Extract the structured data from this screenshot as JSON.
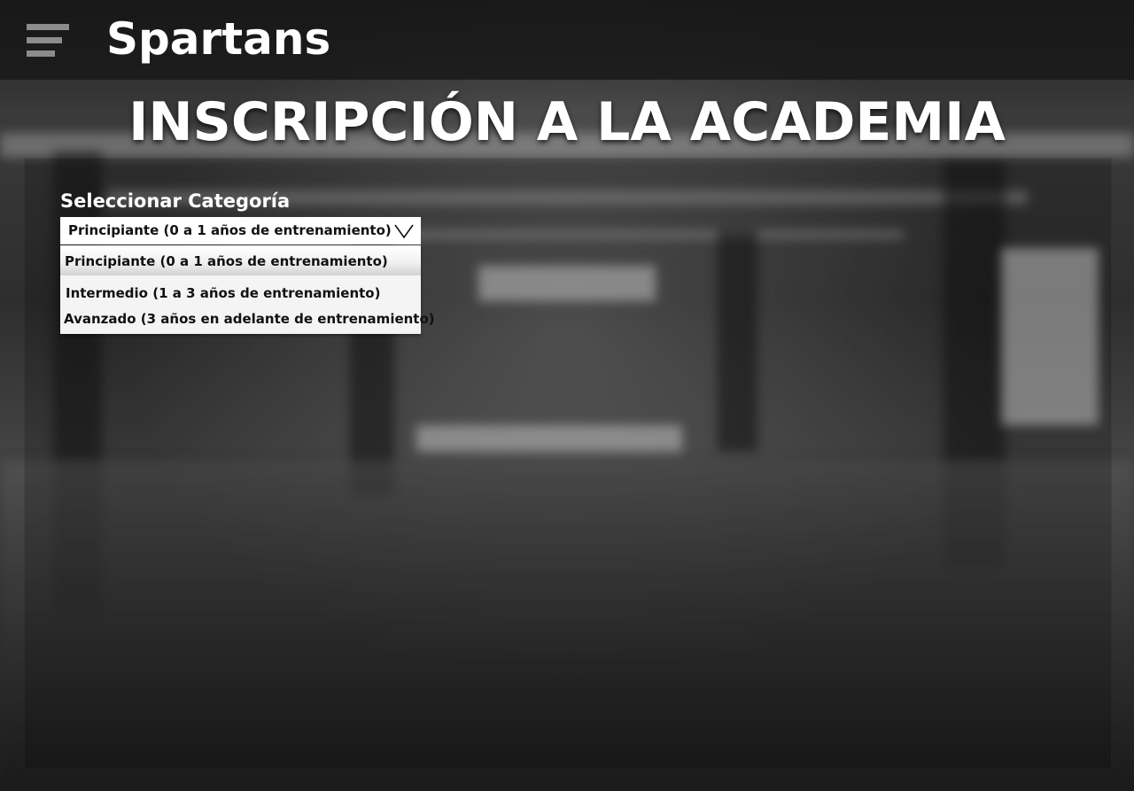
{
  "header": {
    "brand": "Spartans",
    "menu_icon": "hamburger-menu-icon"
  },
  "page": {
    "title": "INSCRIPCIÓN A LA ACADEMIA"
  },
  "form": {
    "category_label": "Seleccionar Categoría",
    "category_select": {
      "selected": "Principiante (0 a 1 años de entrenamiento)",
      "chevron_icon": "chevron-down-icon",
      "options": [
        "Principiante (0 a 1 años de entrenamiento)",
        "Intermedio (1 a 3 años de entrenamiento)",
        "Avanzado (3 años en adelante de entrenamiento)"
      ]
    }
  }
}
